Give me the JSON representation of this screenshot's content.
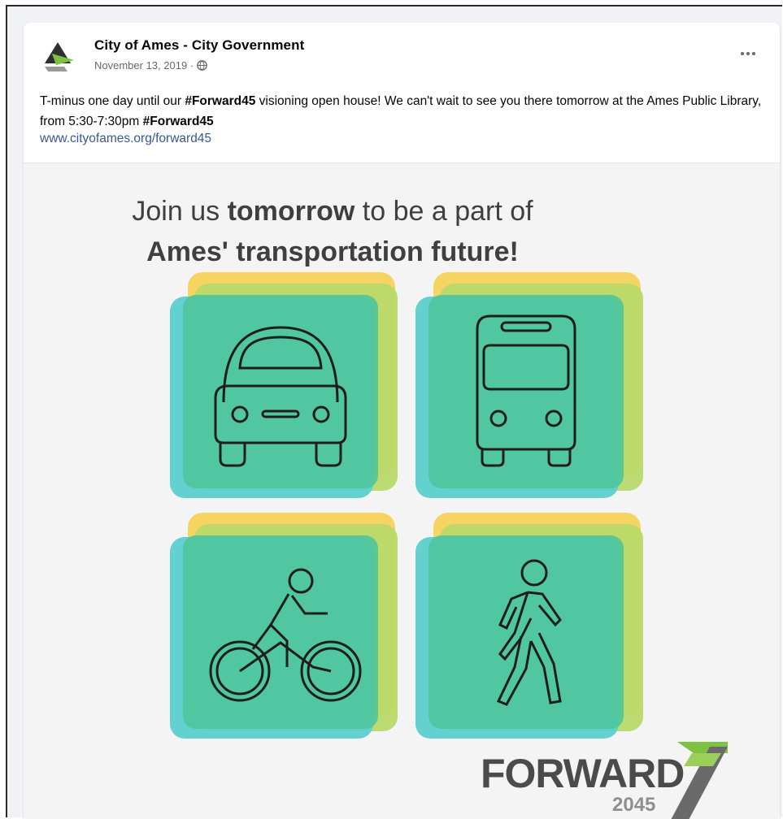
{
  "post": {
    "page_name": "City of Ames - City Government",
    "date": "November 13, 2019 ·",
    "privacy_icon": "globe-icon",
    "more_icon": "more-options-icon",
    "text_1": "T-minus one day until our ",
    "hashtag_1": "#Forward45",
    "text_2": " visioning open house! We can't wait to see you there tomorrow at the Ames Public Library, from 5:30-7:30pm ",
    "hashtag_2": "#Forward45",
    "link": "www.cityofames.org/forward45"
  },
  "graphic": {
    "line1_a": "Join us ",
    "line1_bold": "tomorrow",
    "line1_b": " to be a part of",
    "line2": "Ames' transportation future!",
    "tiles": [
      {
        "icon": "car-icon"
      },
      {
        "icon": "bus-icon"
      },
      {
        "icon": "bicycle-icon"
      },
      {
        "icon": "pedestrian-icon"
      }
    ],
    "logo_word": "FORWARD",
    "logo_year": "2045"
  },
  "colors": {
    "yellow": "#f5d259",
    "lime": "#b8d96a",
    "aqua": "#5ccfcf",
    "green": "#4fc49c",
    "link": "#385898",
    "logo_arrow_green": "#7dc242"
  }
}
